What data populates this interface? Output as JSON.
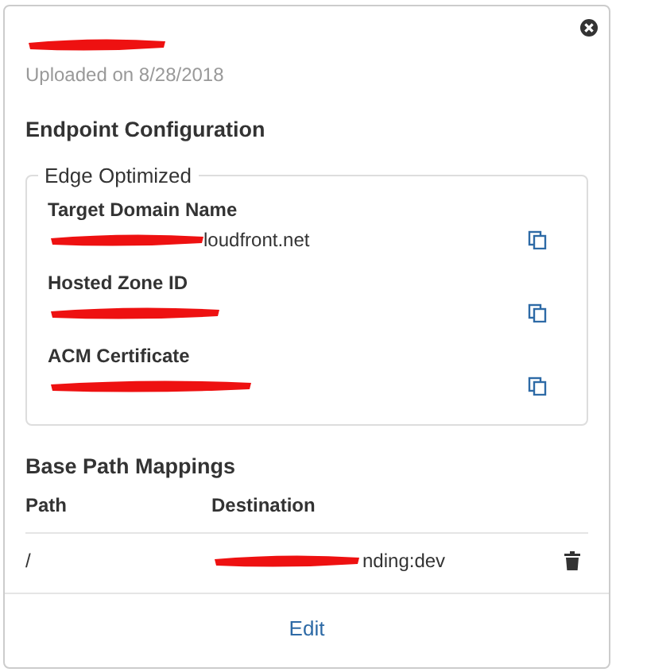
{
  "card": {
    "title_redacted": true,
    "subtitle": "Uploaded on 8/28/2018"
  },
  "endpoint": {
    "heading": "Endpoint Configuration",
    "legend": "Edge Optimized",
    "fields": [
      {
        "label": "Target Domain Name",
        "redacted": true,
        "value": "loudfront.net"
      },
      {
        "label": "Hosted Zone ID",
        "redacted": true
      },
      {
        "label": "ACM Certificate",
        "redacted": true
      }
    ]
  },
  "mappings": {
    "heading": "Base Path Mappings",
    "columns": [
      "Path",
      "Destination"
    ],
    "rows": [
      {
        "path": "/",
        "redacted": true,
        "destination": "nding:dev"
      }
    ]
  },
  "footer": {
    "action": "Edit"
  }
}
